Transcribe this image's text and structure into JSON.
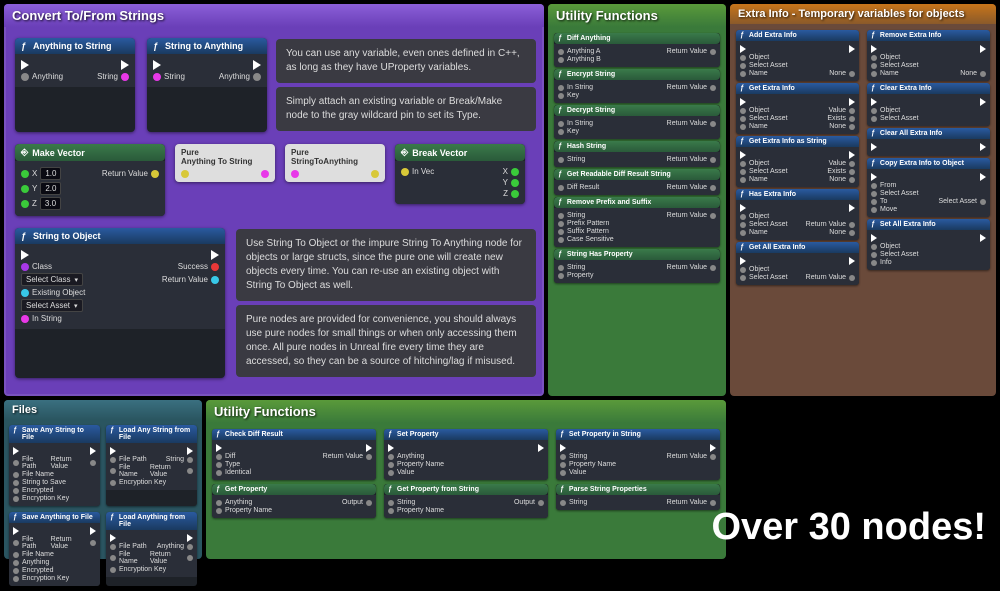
{
  "purple": {
    "title": "Convert To/From Strings",
    "n_anything_to_string": {
      "title": "Anything to String",
      "in": "Anything",
      "out": "String"
    },
    "n_string_to_anything": {
      "title": "String to Anything",
      "in": "String",
      "out": "Anything"
    },
    "info1": "You can use any variable, even ones defined in C++, as long as they have UProperty variables.",
    "info2": "Simply attach an existing variable or Break/Make node to the gray wildcard pin to set its Type.",
    "make_vector": {
      "title": "Make Vector",
      "x": "X",
      "y": "Y",
      "z": "Z",
      "vx": "1.0",
      "vy": "2.0",
      "vz": "3.0",
      "rv": "Return Value"
    },
    "pure1": {
      "l1": "Pure",
      "l2": "Anything To String"
    },
    "pure2": {
      "l1": "Pure",
      "l2": "StringToAnything"
    },
    "break_vector": {
      "title": "Break Vector",
      "in": "In Vec",
      "x": "X",
      "y": "Y",
      "z": "Z"
    },
    "string_to_object": {
      "title": "String to Object",
      "class": "Class",
      "class_v": "Select Class",
      "existing": "Existing Object",
      "existing_v": "Select Asset",
      "instr": "In String",
      "success": "Success",
      "rv": "Return Value"
    },
    "info3": "Use String To Object or the impure String To Anything node for objects or large structs, since the pure one will create new objects every time. You can re-use an existing object with String To Object as well.",
    "info4": "Pure nodes are provided for convenience, you should always use pure nodes for small things or when only accessing them once. All pure nodes in Unreal fire every time they are accessed, so they can be a source of hitching/lag if misused."
  },
  "util1": {
    "title": "Utility Functions",
    "nodes": [
      {
        "title": "Diff Anything",
        "pins": [
          [
            "Anything A",
            "Return Value"
          ],
          [
            "Anything B",
            ""
          ]
        ]
      },
      {
        "title": "Encrypt String",
        "pins": [
          [
            "In String",
            "Return Value"
          ],
          [
            "Key",
            ""
          ]
        ]
      },
      {
        "title": "Decrypt String",
        "pins": [
          [
            "In String",
            "Return Value"
          ],
          [
            "Key",
            ""
          ]
        ]
      },
      {
        "title": "Hash String",
        "pins": [
          [
            "String",
            "Return Value"
          ]
        ]
      },
      {
        "title": "Get Readable Diff Result String",
        "pins": [
          [
            "Diff Result",
            "Return Value"
          ]
        ]
      },
      {
        "title": "Remove Prefix and Suffix",
        "pins": [
          [
            "String",
            "Return Value"
          ],
          [
            "Prefix Pattern",
            ""
          ],
          [
            "Suffix Pattern",
            ""
          ],
          [
            "Case Sensitive",
            ""
          ]
        ]
      },
      {
        "title": "String Has Property",
        "pins": [
          [
            "String",
            "Return Value"
          ],
          [
            "Property",
            ""
          ]
        ]
      }
    ]
  },
  "extra": {
    "title": "Extra Info - Temporary variables for objects",
    "col1": [
      {
        "title": "Add Extra Info",
        "pins": [
          [
            "Object",
            ""
          ],
          [
            "Select Asset",
            ""
          ],
          [
            "Name",
            "None"
          ]
        ]
      },
      {
        "title": "Get Extra Info",
        "pins": [
          [
            "Object",
            "Value"
          ],
          [
            "Select Asset",
            "Exists"
          ],
          [
            "Name",
            "None"
          ]
        ]
      },
      {
        "title": "Get Extra Info as String",
        "pins": [
          [
            "Object",
            "Value"
          ],
          [
            "Select Asset",
            "Exists"
          ],
          [
            "Name",
            "None"
          ]
        ]
      },
      {
        "title": "Has Extra Info",
        "pins": [
          [
            "Object",
            ""
          ],
          [
            "Select Asset",
            "Return Value"
          ],
          [
            "Name",
            "None"
          ]
        ]
      },
      {
        "title": "Get All Extra Info",
        "pins": [
          [
            "Object",
            ""
          ],
          [
            "Select Asset",
            "Return Value"
          ]
        ]
      }
    ],
    "col2": [
      {
        "title": "Remove Extra Info",
        "pins": [
          [
            "Object",
            ""
          ],
          [
            "Select Asset",
            ""
          ],
          [
            "Name",
            "None"
          ]
        ]
      },
      {
        "title": "Clear Extra Info",
        "pins": [
          [
            "Object",
            ""
          ],
          [
            "Select Asset",
            ""
          ]
        ]
      },
      {
        "title": "Clear All Extra Info",
        "pins": [
          [
            "",
            ""
          ]
        ]
      },
      {
        "title": "Copy Extra Info to Object",
        "pins": [
          [
            "From",
            ""
          ],
          [
            "Select Asset",
            ""
          ],
          [
            "To",
            "Select Asset"
          ],
          [
            "Move",
            ""
          ]
        ]
      },
      {
        "title": "Set All Extra Info",
        "pins": [
          [
            "Object",
            ""
          ],
          [
            "Select Asset",
            ""
          ],
          [
            "Info",
            ""
          ]
        ]
      }
    ]
  },
  "files": {
    "title": "Files",
    "nodes": [
      {
        "title": "Save Any String to File",
        "pins": [
          [
            "File Path",
            "Return Value"
          ],
          [
            "File Name",
            ""
          ],
          [
            "String to Save",
            ""
          ],
          [
            "Encrypted",
            ""
          ],
          [
            "Encryption Key",
            ""
          ]
        ]
      },
      {
        "title": "Load Any String from File",
        "pins": [
          [
            "File Path",
            "String"
          ],
          [
            "File Name",
            "Return Value"
          ],
          [
            "Encryption Key",
            ""
          ]
        ]
      },
      {
        "title": "Save Anything to File",
        "pins": [
          [
            "File Path",
            "Return Value"
          ],
          [
            "File Name",
            ""
          ],
          [
            "Anything",
            ""
          ],
          [
            "Encrypted",
            ""
          ],
          [
            "Encryption Key",
            ""
          ]
        ]
      },
      {
        "title": "Load Anything from File",
        "pins": [
          [
            "File Path",
            "Anything"
          ],
          [
            "File Name",
            "Return Value"
          ],
          [
            "Encryption Key",
            ""
          ]
        ]
      }
    ]
  },
  "util2": {
    "title": "Utility Functions",
    "row1": [
      {
        "title": "Check Diff Result",
        "pins": [
          [
            "Diff",
            "Return Value"
          ],
          [
            "Type",
            ""
          ],
          [
            "Identical",
            ""
          ]
        ]
      },
      {
        "title": "Set Property",
        "pins": [
          [
            "Anything",
            ""
          ],
          [
            "Property Name",
            ""
          ],
          [
            "Value",
            ""
          ]
        ]
      },
      {
        "title": "Set Property in String",
        "pins": [
          [
            "String",
            "Return Value"
          ],
          [
            "Property Name",
            ""
          ],
          [
            "Value",
            ""
          ]
        ]
      }
    ],
    "row2": [
      {
        "title": "Get Property",
        "pins": [
          [
            "Anything",
            "Output"
          ],
          [
            "Property Name",
            ""
          ]
        ]
      },
      {
        "title": "Get Property from String",
        "pins": [
          [
            "String",
            "Output"
          ],
          [
            "Property Name",
            ""
          ]
        ]
      },
      {
        "title": "Parse String Properties",
        "pins": [
          [
            "String",
            "Return Value"
          ]
        ]
      }
    ]
  },
  "tagline": "Over 30 nodes!"
}
